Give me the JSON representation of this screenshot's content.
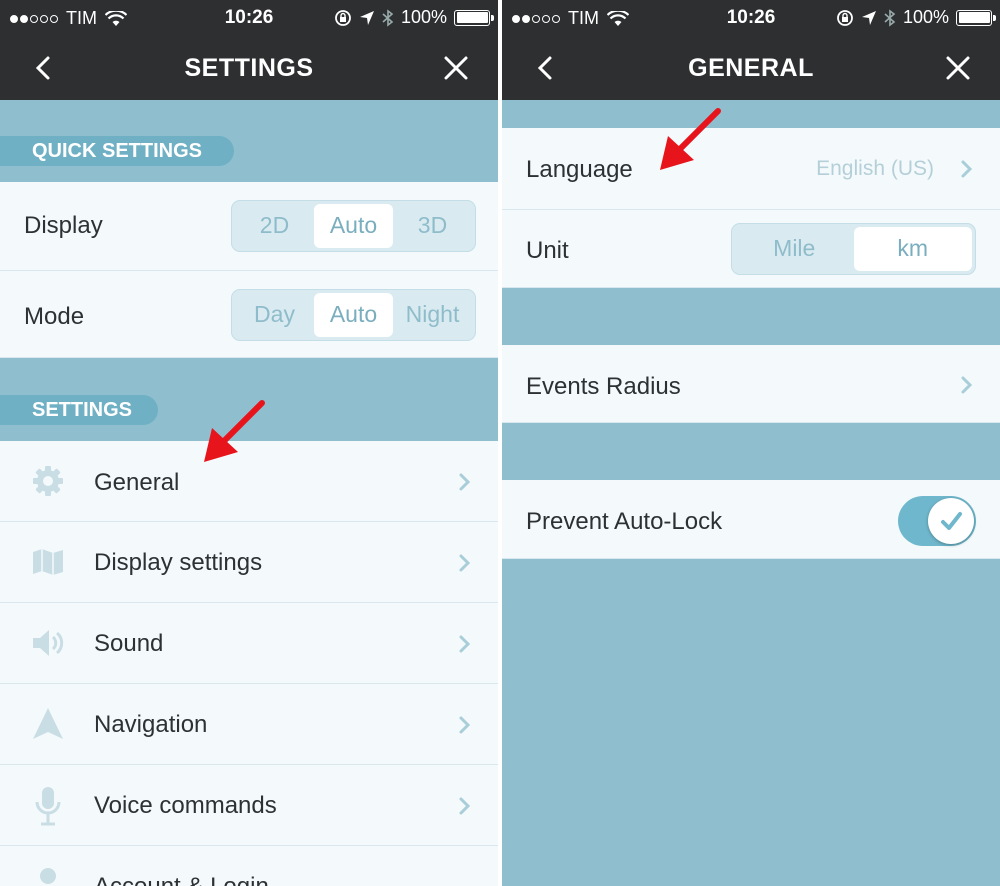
{
  "status_bar": {
    "carrier": "TIM",
    "time": "10:26",
    "battery": "100%"
  },
  "left": {
    "nav_title": "SETTINGS",
    "quick_settings_header": "QUICK SETTINGS",
    "display": {
      "label": "Display",
      "options": [
        "2D",
        "Auto",
        "3D"
      ],
      "selected": "Auto"
    },
    "mode": {
      "label": "Mode",
      "options": [
        "Day",
        "Auto",
        "Night"
      ],
      "selected": "Auto"
    },
    "settings_header": "SETTINGS",
    "menu": [
      {
        "label": "General",
        "icon": "gear-icon"
      },
      {
        "label": "Display settings",
        "icon": "map-icon"
      },
      {
        "label": "Sound",
        "icon": "speaker-icon"
      },
      {
        "label": "Navigation",
        "icon": "navigation-arrow-icon"
      },
      {
        "label": "Voice commands",
        "icon": "microphone-icon"
      },
      {
        "label": "Account & Login",
        "icon": "person-icon"
      }
    ]
  },
  "right": {
    "nav_title": "GENERAL",
    "language": {
      "label": "Language",
      "value": "English (US)"
    },
    "unit": {
      "label": "Unit",
      "options": [
        "Mile",
        "km"
      ],
      "selected": "km"
    },
    "events_radius": {
      "label": "Events Radius"
    },
    "prevent_auto_lock": {
      "label": "Prevent Auto-Lock",
      "enabled": true
    }
  },
  "colors": {
    "navbar": "#2d2f31",
    "section_band": "#8fbfce",
    "row_background": "#f4fafc",
    "accent": "#6fb7cc",
    "annotation_arrow": "#e8141c"
  }
}
